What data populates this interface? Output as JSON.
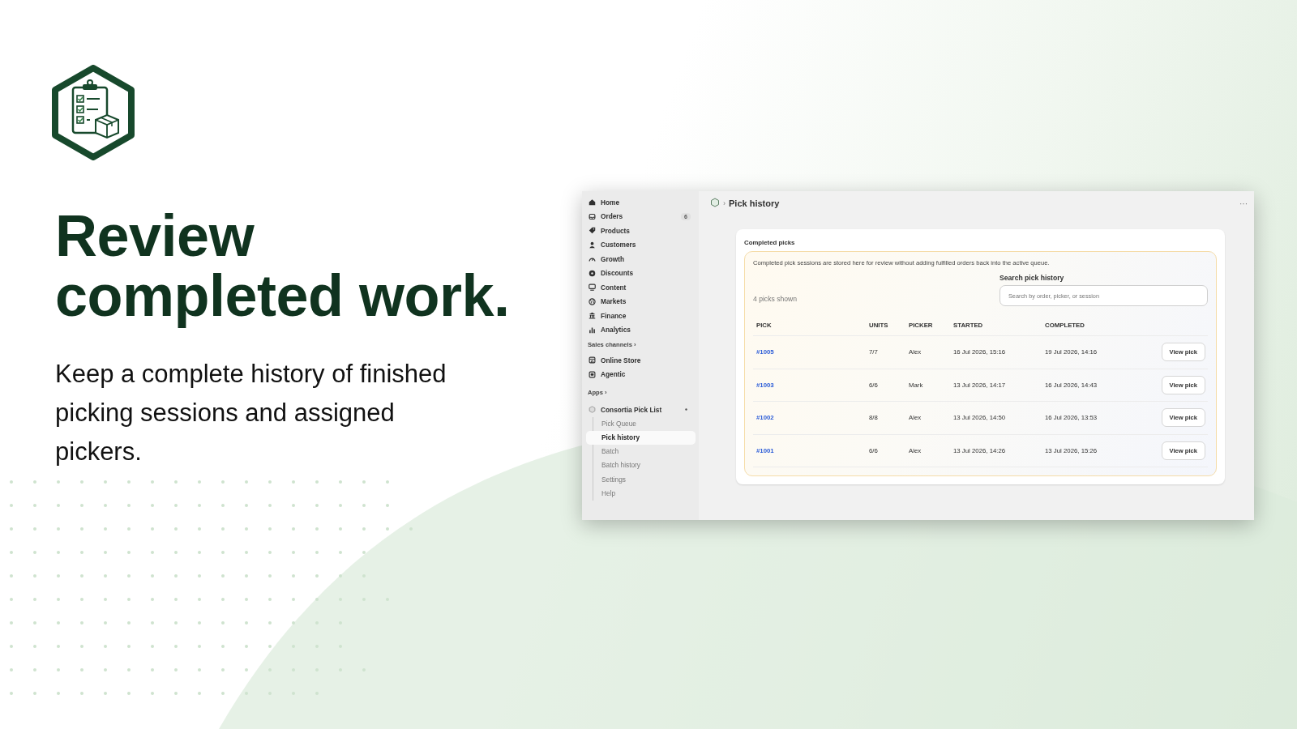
{
  "headline": "Review completed work.",
  "subtext": "Keep a complete history of finished picking sessions and assigned pickers.",
  "app": {
    "sidebar": {
      "items": [
        {
          "label": "Home"
        },
        {
          "label": "Orders",
          "badge": "6"
        },
        {
          "label": "Products"
        },
        {
          "label": "Customers"
        },
        {
          "label": "Growth"
        },
        {
          "label": "Discounts"
        },
        {
          "label": "Content"
        },
        {
          "label": "Markets"
        },
        {
          "label": "Finance"
        },
        {
          "label": "Analytics"
        }
      ],
      "sales_channels": {
        "heading": "Sales channels ›",
        "items": [
          {
            "label": "Online Store"
          },
          {
            "label": "Agentic"
          }
        ]
      },
      "apps": {
        "heading": "Apps ›",
        "app": {
          "label": "Consortia Pick List",
          "pages": [
            {
              "label": "Pick Queue",
              "selected": false
            },
            {
              "label": "Pick history",
              "selected": true
            },
            {
              "label": "Batch",
              "selected": false
            },
            {
              "label": "Batch history",
              "selected": false
            },
            {
              "label": "Settings",
              "selected": false
            },
            {
              "label": "Help",
              "selected": false
            }
          ]
        }
      }
    },
    "header": {
      "separator": "›",
      "title": "Pick history",
      "menu": "···"
    },
    "card": {
      "title": "Completed picks",
      "note": "Completed pick sessions are stored here for review without adding fulfilled orders back into the active queue.",
      "count": "4 picks shown",
      "search": {
        "label": "Search pick history",
        "placeholder": "Search by order, picker, or session"
      },
      "table": {
        "columns": [
          "PICK",
          "UNITS",
          "PICKER",
          "STARTED",
          "COMPLETED"
        ],
        "rows": [
          {
            "pick": "#1005",
            "units": "7/7",
            "picker": "Alex",
            "started": "16 Jul 2026, 15:16",
            "completed": "19 Jul 2026, 14:16",
            "action": "View pick"
          },
          {
            "pick": "#1003",
            "units": "6/6",
            "picker": "Mark",
            "started": "13 Jul 2026, 14:17",
            "completed": "16 Jul 2026, 14:43",
            "action": "View pick"
          },
          {
            "pick": "#1002",
            "units": "8/8",
            "picker": "Alex",
            "started": "13 Jul 2026, 14:50",
            "completed": "16 Jul 2026, 13:53",
            "action": "View pick"
          },
          {
            "pick": "#1001",
            "units": "6/6",
            "picker": "Alex",
            "started": "13 Jul 2026, 14:26",
            "completed": "13 Jul 2026, 15:26",
            "action": "View pick"
          }
        ]
      }
    }
  }
}
